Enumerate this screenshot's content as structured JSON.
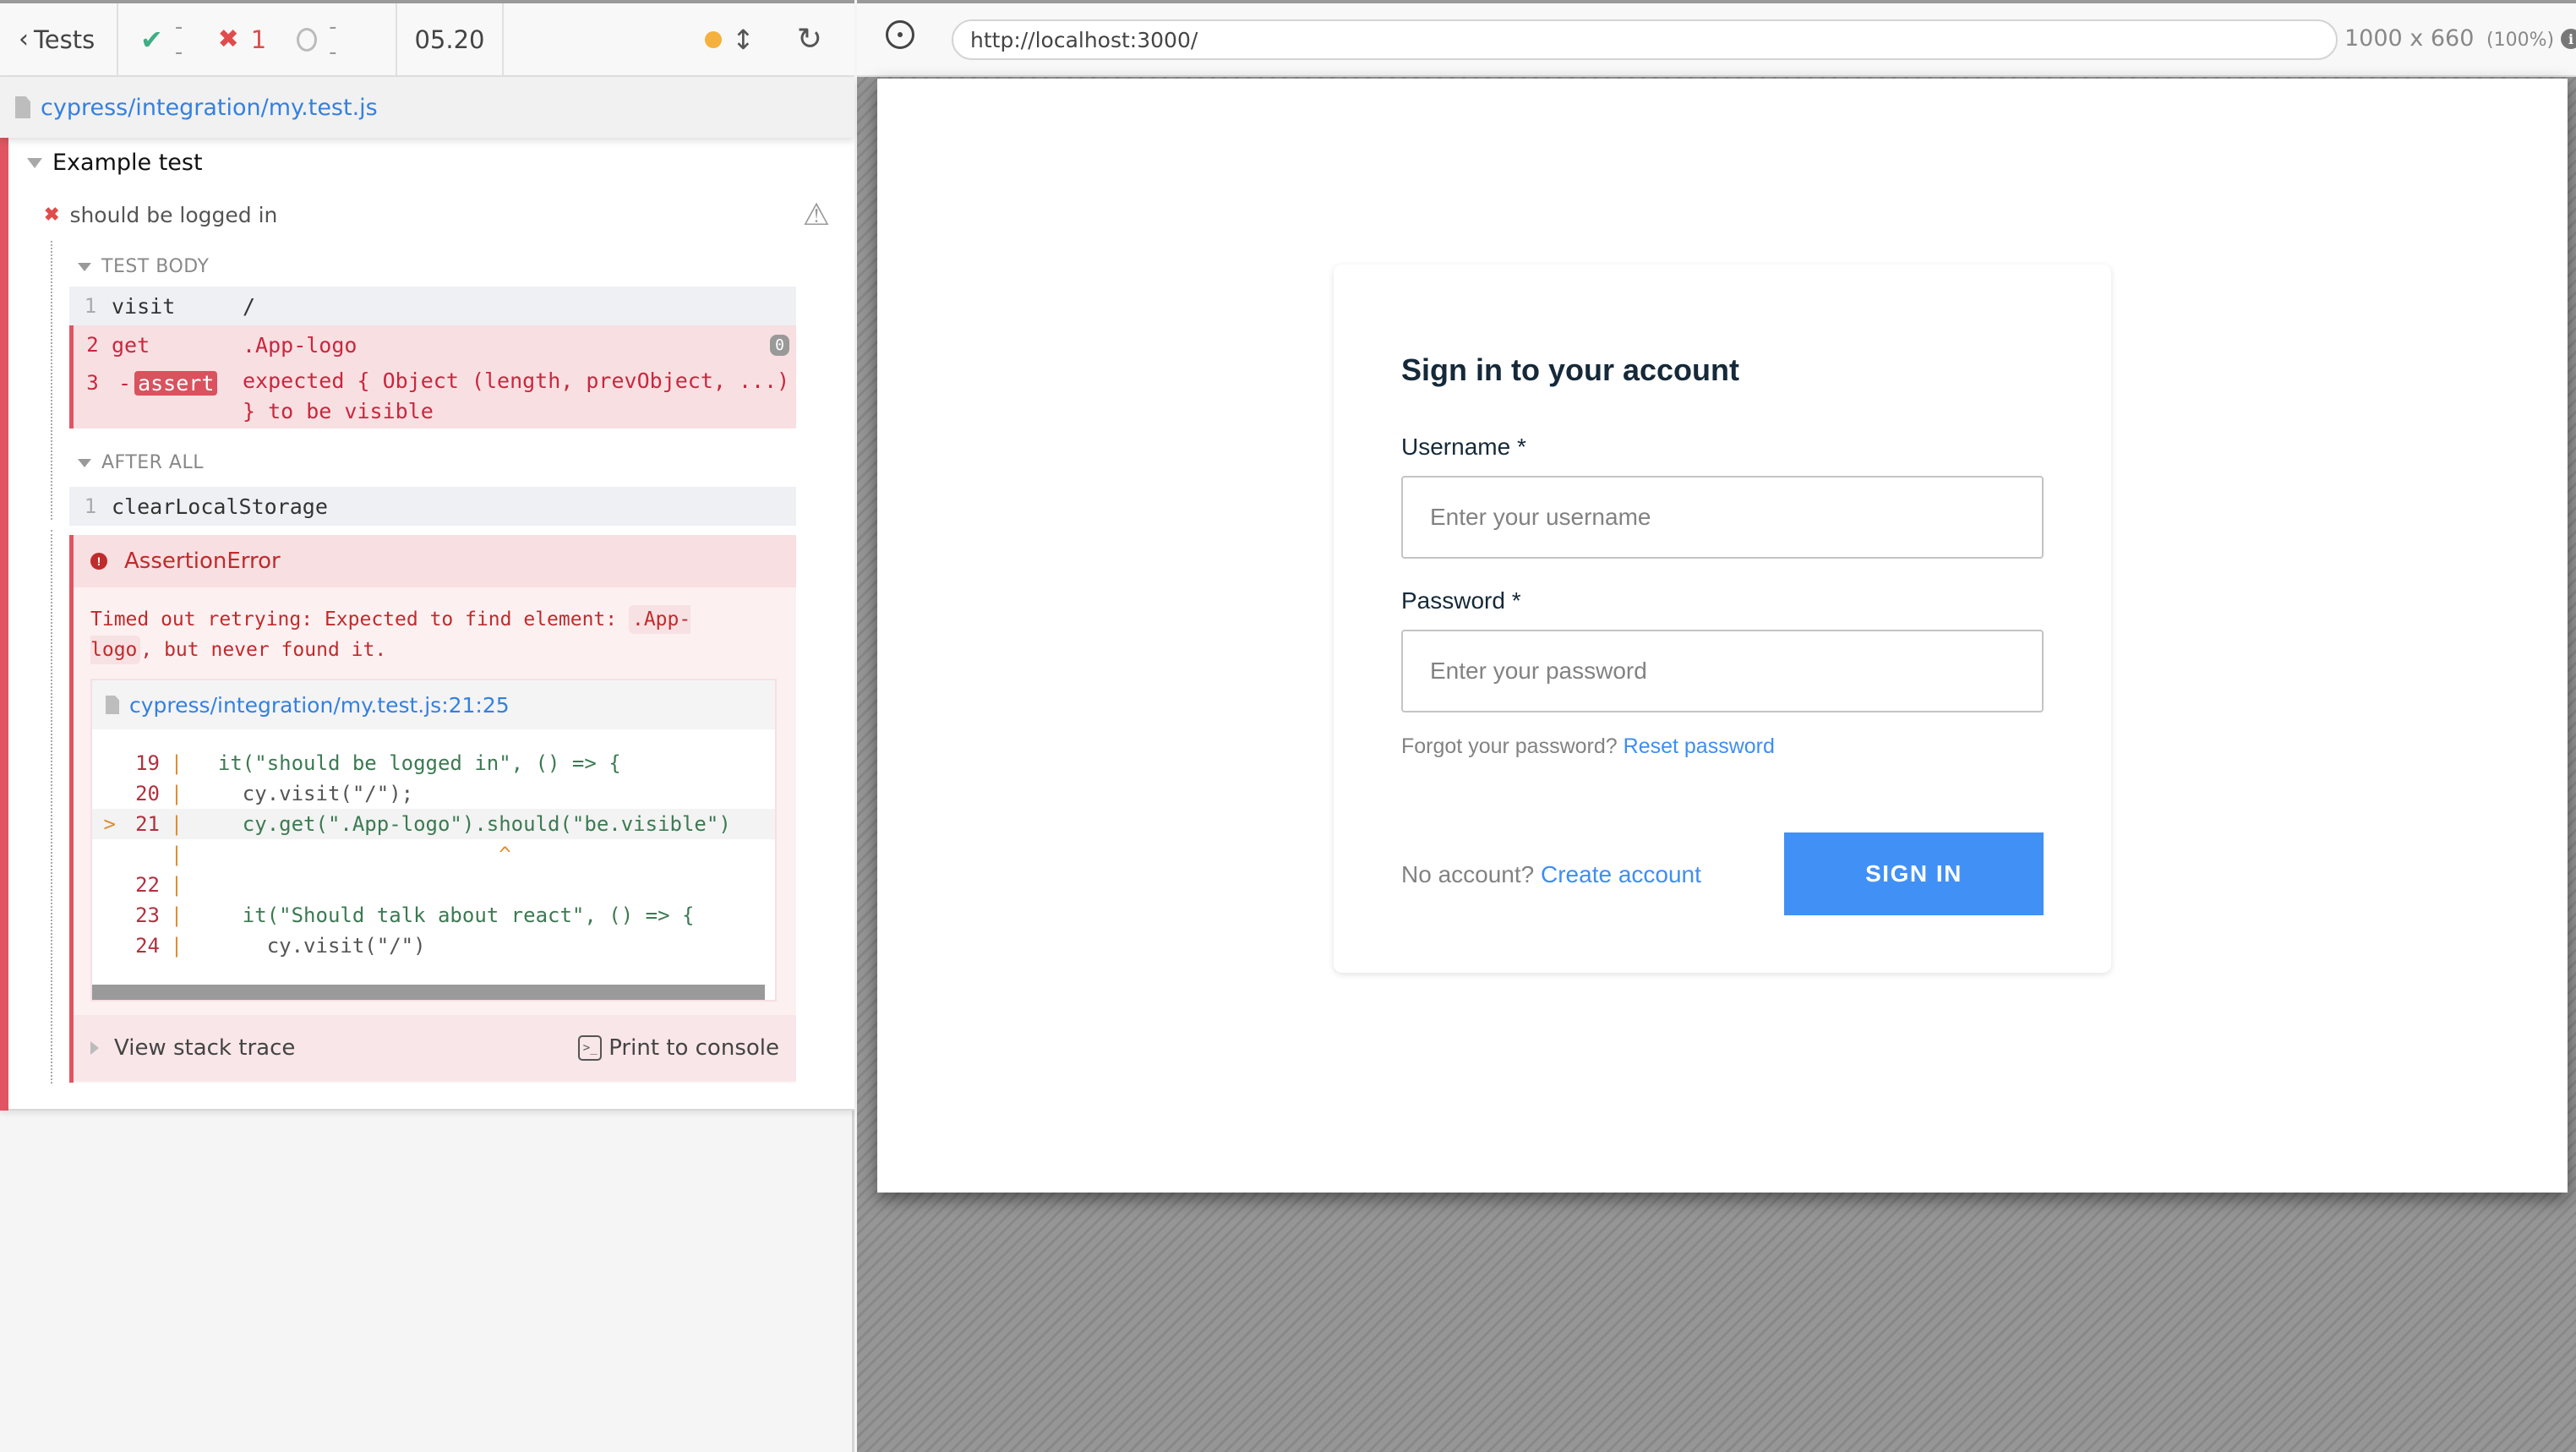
{
  "reporter": {
    "header": {
      "back_label": "Tests",
      "passed_count": "--",
      "failed_count": "1",
      "pending_count": "--",
      "duration": "05.20",
      "status_dot_color": "#f5b13d"
    },
    "spec_file": "cypress/integration/my.test.js",
    "suite": {
      "title": "Example test",
      "test": {
        "title": "should be logged in",
        "state": "failed",
        "hooks": [
          {
            "title": "TEST BODY",
            "commands": [
              {
                "num": "1",
                "name": "visit",
                "message": "/",
                "state": "passed"
              },
              {
                "num": "2",
                "name": "get",
                "message": ".App-logo",
                "badge": "0",
                "state": "failed"
              },
              {
                "num": "3",
                "prefix": "-",
                "name": "assert",
                "message_line1": "expected { Object (length, prevObject, ...)",
                "message_line2": "} to be visible",
                "state": "failed"
              }
            ]
          },
          {
            "title": "AFTER ALL",
            "commands": [
              {
                "num": "1",
                "name": "clearLocalStorage",
                "message": "",
                "state": "passed"
              }
            ]
          }
        ],
        "error": {
          "name": "AssertionError",
          "message_part1": "Timed out retrying: Expected to find element: ",
          "message_code1": ".App-",
          "message_code2": "logo",
          "message_part2": ", but never found it.",
          "code_frame": {
            "file": "cypress/integration/my.test.js:21:25",
            "lines": [
              {
                "marker": "",
                "num": "19",
                "code": "  it(\"should be logged in\", () => {"
              },
              {
                "marker": "",
                "num": "20",
                "code": "    cy.visit(\"/\");"
              },
              {
                "marker": ">",
                "num": "21",
                "code": "    cy.get(\".App-logo\").should(\"be.visible\")",
                "highlight": true
              },
              {
                "marker": "",
                "num": "",
                "code": "                         ^"
              },
              {
                "marker": "",
                "num": "22",
                "code": ""
              },
              {
                "marker": "",
                "num": "23",
                "code": "    it(\"Should talk about react\", () => {"
              },
              {
                "marker": "",
                "num": "24",
                "code": "      cy.visit(\"/\")"
              }
            ]
          },
          "view_stack_trace_label": "View stack trace",
          "print_to_console_label": "Print to console"
        }
      }
    }
  },
  "aut": {
    "url": "http://localhost:3000/",
    "viewport_size": "1000 x 660",
    "viewport_scale": "(100%)"
  },
  "app": {
    "title": "Sign in to your account",
    "username_label": "Username *",
    "username_placeholder": "Enter your username",
    "username_value": "",
    "password_label": "Password *",
    "password_placeholder": "Enter your password",
    "password_value": "",
    "forgot_text": "Forgot your password?",
    "reset_link": "Reset password",
    "no_account_text": "No account?",
    "create_link": "Create account",
    "signin_label": "SIGN IN",
    "accent_color": "#4190f5"
  }
}
